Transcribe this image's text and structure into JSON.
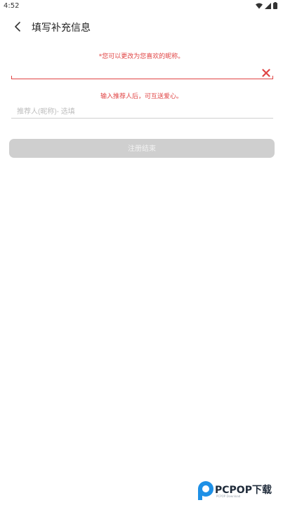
{
  "status_bar": {
    "time": "4:52",
    "icons": [
      "wifi-icon",
      "signal-icon",
      "battery-icon"
    ]
  },
  "app_bar": {
    "back_icon": "back-arrow-icon",
    "title": "填写补充信息"
  },
  "form": {
    "nickname_hint": "*您可以更改为您喜欢的昵称。",
    "nickname_value": "",
    "nickname_error_color": "#e04444",
    "clear_icon": "close-icon",
    "referrer_hint": "输入推荐人后，可互送爱心。",
    "referrer_placeholder": "推荐人(昵称)- 选填",
    "referrer_value": "",
    "submit_label": "注册结束",
    "submit_enabled": false
  },
  "watermark": {
    "brand": "PCPOP下载",
    "sub": "PCPOP Download"
  }
}
